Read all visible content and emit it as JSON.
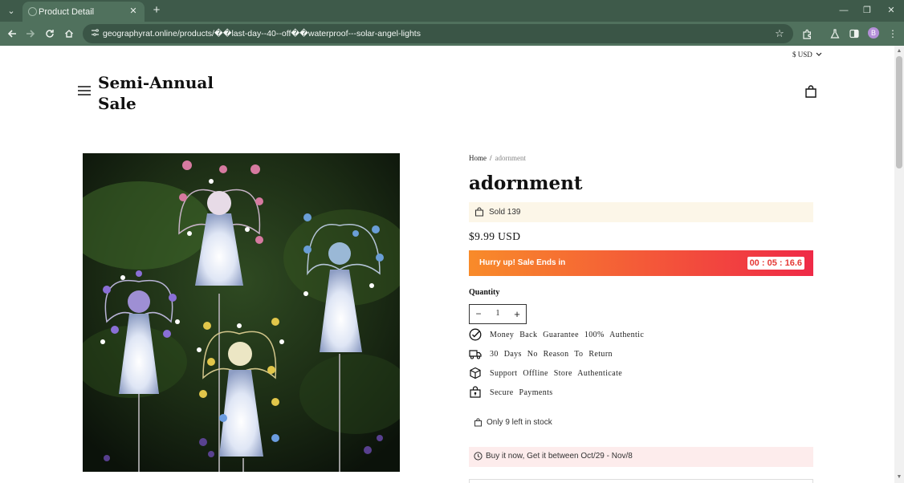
{
  "browser": {
    "tab_title": "Product Detail",
    "url": "geographyrat.online/products/��last-day--40--off��waterproof---solar-angel-lights",
    "profile_initial": "B"
  },
  "header": {
    "currency": "$ USD",
    "brand": "Semi-Annual Sale"
  },
  "breadcrumb": {
    "home": "Home",
    "separator": "/",
    "current": "adornment"
  },
  "product": {
    "title": "adornment",
    "sold": "Sold 139",
    "price": "$9.99 USD"
  },
  "sale_banner": {
    "text": "Hurry up! Sale Ends in",
    "countdown": "00 : 05 : 16.6"
  },
  "quantity": {
    "label": "Quantity",
    "value": "1",
    "minus": "−",
    "plus": "+"
  },
  "features": [
    {
      "icon": "check-circle-icon",
      "text": "Money Back Guarantee 100% Authentic"
    },
    {
      "icon": "truck-icon",
      "text": "30 Days No Reason To Return"
    },
    {
      "icon": "box-icon",
      "text": "Support Offline Store Authenticate"
    },
    {
      "icon": "lock-bag-icon",
      "text": "Secure Payments"
    }
  ],
  "stock": "Only 9 left in stock",
  "shipping": "Buy it now, Get it between Oct/29 - Nov/8",
  "colors": {
    "chrome_dark": "#3e5a4a",
    "chrome": "#50715d",
    "sold_bg": "#fcf6e8",
    "ship_bg": "#fdecec",
    "countdown": "#e53935"
  }
}
